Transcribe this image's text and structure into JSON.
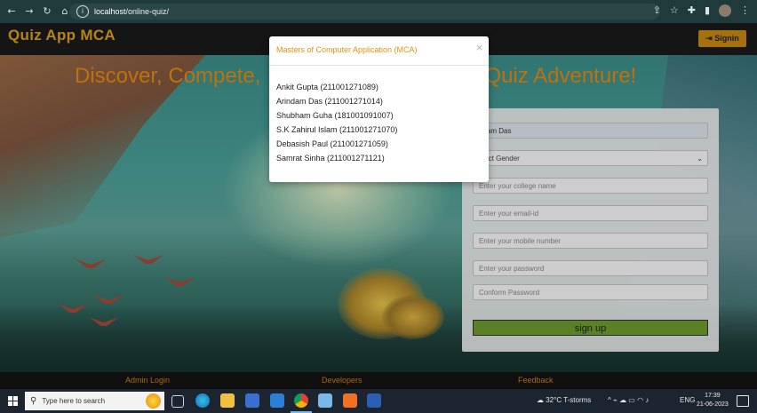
{
  "browser": {
    "url_host": "localhost",
    "url_path": "/online-quiz/",
    "nav_icons": [
      "back-arrow-icon",
      "forward-arrow-icon",
      "reload-icon",
      "home-icon"
    ],
    "toolbar_icons": [
      "share-icon",
      "star-icon",
      "extensions-icon",
      "sidebar-icon",
      "profile-avatar-icon",
      "menu-dots-icon"
    ]
  },
  "header": {
    "brand": "Quiz App MCA",
    "signin_label": "Signin",
    "accent_color": "#e0a21a"
  },
  "hero": {
    "title_left": "Discover, Compete,",
    "title_right": "e Quiz Adventure!"
  },
  "form": {
    "name_value": "ndam Das",
    "gender_value": "elect Gender",
    "college_placeholder": "Enter your college name",
    "email_placeholder": "Enter your email-id",
    "mobile_placeholder": "Enter your mobile number",
    "password_placeholder": "Enter your password",
    "confirm_placeholder": "Conform Password",
    "signup_label": "sign up",
    "signup_color": "#6f9e30"
  },
  "footer": {
    "admin_login": "Admin Login",
    "developers": "Developers",
    "feedback": "Feedback"
  },
  "modal": {
    "title": "Masters of Computer Application (MCA)",
    "close_label": "×",
    "members": [
      "Ankit Gupta (211001271089)",
      "Arindam Das (211001271014)",
      "Shubham Guha (181001091007)",
      "S.K Zahirul Islam (211001271070)",
      "Debasish Paul (211001271059)",
      "Samrat Sinha (211001271121)"
    ]
  },
  "taskbar": {
    "search_placeholder": "Type here to search",
    "weather": "32°C  T-storms",
    "language": "ENG",
    "time": "17:39",
    "date": "21-06-2023",
    "pinned_apps": [
      "task-view-icon",
      "edge-icon",
      "file-explorer-icon",
      "store-icon",
      "mail-icon",
      "chrome-icon",
      "app-icon",
      "xampp-icon",
      "word-icon"
    ]
  }
}
